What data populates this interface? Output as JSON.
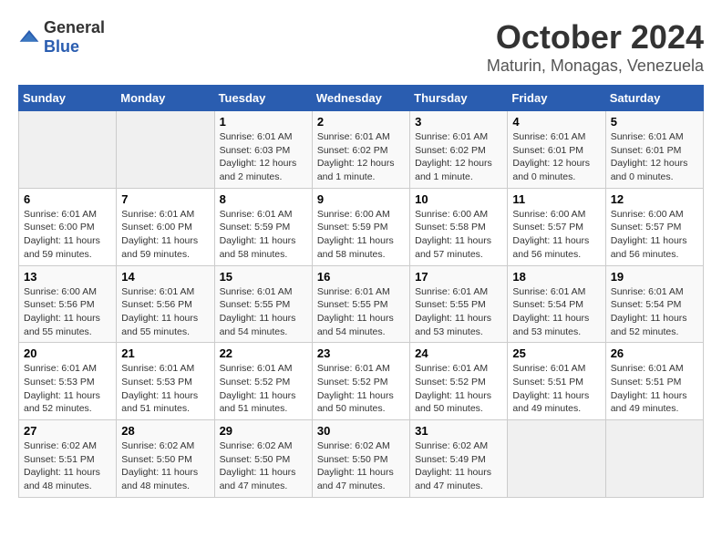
{
  "logo": {
    "general": "General",
    "blue": "Blue"
  },
  "title": "October 2024",
  "subtitle": "Maturin, Monagas, Venezuela",
  "days_header": [
    "Sunday",
    "Monday",
    "Tuesday",
    "Wednesday",
    "Thursday",
    "Friday",
    "Saturday"
  ],
  "weeks": [
    [
      {
        "day": "",
        "empty": true
      },
      {
        "day": "",
        "empty": true
      },
      {
        "day": "1",
        "sunrise": "Sunrise: 6:01 AM",
        "sunset": "Sunset: 6:03 PM",
        "daylight": "Daylight: 12 hours and 2 minutes."
      },
      {
        "day": "2",
        "sunrise": "Sunrise: 6:01 AM",
        "sunset": "Sunset: 6:02 PM",
        "daylight": "Daylight: 12 hours and 1 minute."
      },
      {
        "day": "3",
        "sunrise": "Sunrise: 6:01 AM",
        "sunset": "Sunset: 6:02 PM",
        "daylight": "Daylight: 12 hours and 1 minute."
      },
      {
        "day": "4",
        "sunrise": "Sunrise: 6:01 AM",
        "sunset": "Sunset: 6:01 PM",
        "daylight": "Daylight: 12 hours and 0 minutes."
      },
      {
        "day": "5",
        "sunrise": "Sunrise: 6:01 AM",
        "sunset": "Sunset: 6:01 PM",
        "daylight": "Daylight: 12 hours and 0 minutes."
      }
    ],
    [
      {
        "day": "6",
        "sunrise": "Sunrise: 6:01 AM",
        "sunset": "Sunset: 6:00 PM",
        "daylight": "Daylight: 11 hours and 59 minutes."
      },
      {
        "day": "7",
        "sunrise": "Sunrise: 6:01 AM",
        "sunset": "Sunset: 6:00 PM",
        "daylight": "Daylight: 11 hours and 59 minutes."
      },
      {
        "day": "8",
        "sunrise": "Sunrise: 6:01 AM",
        "sunset": "Sunset: 5:59 PM",
        "daylight": "Daylight: 11 hours and 58 minutes."
      },
      {
        "day": "9",
        "sunrise": "Sunrise: 6:00 AM",
        "sunset": "Sunset: 5:59 PM",
        "daylight": "Daylight: 11 hours and 58 minutes."
      },
      {
        "day": "10",
        "sunrise": "Sunrise: 6:00 AM",
        "sunset": "Sunset: 5:58 PM",
        "daylight": "Daylight: 11 hours and 57 minutes."
      },
      {
        "day": "11",
        "sunrise": "Sunrise: 6:00 AM",
        "sunset": "Sunset: 5:57 PM",
        "daylight": "Daylight: 11 hours and 56 minutes."
      },
      {
        "day": "12",
        "sunrise": "Sunrise: 6:00 AM",
        "sunset": "Sunset: 5:57 PM",
        "daylight": "Daylight: 11 hours and 56 minutes."
      }
    ],
    [
      {
        "day": "13",
        "sunrise": "Sunrise: 6:00 AM",
        "sunset": "Sunset: 5:56 PM",
        "daylight": "Daylight: 11 hours and 55 minutes."
      },
      {
        "day": "14",
        "sunrise": "Sunrise: 6:01 AM",
        "sunset": "Sunset: 5:56 PM",
        "daylight": "Daylight: 11 hours and 55 minutes."
      },
      {
        "day": "15",
        "sunrise": "Sunrise: 6:01 AM",
        "sunset": "Sunset: 5:55 PM",
        "daylight": "Daylight: 11 hours and 54 minutes."
      },
      {
        "day": "16",
        "sunrise": "Sunrise: 6:01 AM",
        "sunset": "Sunset: 5:55 PM",
        "daylight": "Daylight: 11 hours and 54 minutes."
      },
      {
        "day": "17",
        "sunrise": "Sunrise: 6:01 AM",
        "sunset": "Sunset: 5:55 PM",
        "daylight": "Daylight: 11 hours and 53 minutes."
      },
      {
        "day": "18",
        "sunrise": "Sunrise: 6:01 AM",
        "sunset": "Sunset: 5:54 PM",
        "daylight": "Daylight: 11 hours and 53 minutes."
      },
      {
        "day": "19",
        "sunrise": "Sunrise: 6:01 AM",
        "sunset": "Sunset: 5:54 PM",
        "daylight": "Daylight: 11 hours and 52 minutes."
      }
    ],
    [
      {
        "day": "20",
        "sunrise": "Sunrise: 6:01 AM",
        "sunset": "Sunset: 5:53 PM",
        "daylight": "Daylight: 11 hours and 52 minutes."
      },
      {
        "day": "21",
        "sunrise": "Sunrise: 6:01 AM",
        "sunset": "Sunset: 5:53 PM",
        "daylight": "Daylight: 11 hours and 51 minutes."
      },
      {
        "day": "22",
        "sunrise": "Sunrise: 6:01 AM",
        "sunset": "Sunset: 5:52 PM",
        "daylight": "Daylight: 11 hours and 51 minutes."
      },
      {
        "day": "23",
        "sunrise": "Sunrise: 6:01 AM",
        "sunset": "Sunset: 5:52 PM",
        "daylight": "Daylight: 11 hours and 50 minutes."
      },
      {
        "day": "24",
        "sunrise": "Sunrise: 6:01 AM",
        "sunset": "Sunset: 5:52 PM",
        "daylight": "Daylight: 11 hours and 50 minutes."
      },
      {
        "day": "25",
        "sunrise": "Sunrise: 6:01 AM",
        "sunset": "Sunset: 5:51 PM",
        "daylight": "Daylight: 11 hours and 49 minutes."
      },
      {
        "day": "26",
        "sunrise": "Sunrise: 6:01 AM",
        "sunset": "Sunset: 5:51 PM",
        "daylight": "Daylight: 11 hours and 49 minutes."
      }
    ],
    [
      {
        "day": "27",
        "sunrise": "Sunrise: 6:02 AM",
        "sunset": "Sunset: 5:51 PM",
        "daylight": "Daylight: 11 hours and 48 minutes."
      },
      {
        "day": "28",
        "sunrise": "Sunrise: 6:02 AM",
        "sunset": "Sunset: 5:50 PM",
        "daylight": "Daylight: 11 hours and 48 minutes."
      },
      {
        "day": "29",
        "sunrise": "Sunrise: 6:02 AM",
        "sunset": "Sunset: 5:50 PM",
        "daylight": "Daylight: 11 hours and 47 minutes."
      },
      {
        "day": "30",
        "sunrise": "Sunrise: 6:02 AM",
        "sunset": "Sunset: 5:50 PM",
        "daylight": "Daylight: 11 hours and 47 minutes."
      },
      {
        "day": "31",
        "sunrise": "Sunrise: 6:02 AM",
        "sunset": "Sunset: 5:49 PM",
        "daylight": "Daylight: 11 hours and 47 minutes."
      },
      {
        "day": "",
        "empty": true
      },
      {
        "day": "",
        "empty": true
      }
    ]
  ]
}
